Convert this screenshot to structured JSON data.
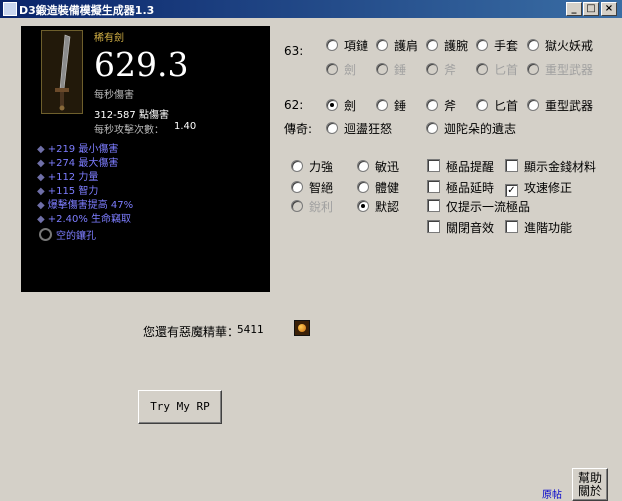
{
  "window": {
    "title": "D3鍛造裝備模擬生成器1.3",
    "minimize": "_",
    "maximize": "□",
    "close": "×"
  },
  "item": {
    "quality": "稀有劍",
    "dps": "629.3",
    "dps_label": "每秒傷害",
    "damage": "312-587 點傷害",
    "speed_label": "每秒攻擊次數：",
    "speed_value": "1.40",
    "stats": [
      "+219 最小傷害",
      "+274 最大傷害",
      "+112 力量",
      "+115 智力",
      "爆擊傷害提高 47%",
      "+2.40% 生命竊取"
    ],
    "socket": "空的鑲孔"
  },
  "row63": {
    "label": "63:",
    "options": [
      "項鏈",
      "護肩",
      "護腕",
      "手套",
      "獄火妖戒"
    ],
    "options_disabled": [
      "劍",
      "錘",
      "斧",
      "匕首",
      "重型武器"
    ]
  },
  "row62": {
    "label": "62:",
    "options": [
      "劍",
      "錘",
      "斧",
      "匕首",
      "重型武器"
    ],
    "selected": "劍"
  },
  "legend": {
    "label": "傳奇:",
    "options": [
      "迴盪狂怒",
      "迦陀朵的遺志"
    ]
  },
  "attributes": [
    "力強",
    "敏迅",
    "智絕",
    "體健",
    "銳利",
    "默認"
  ],
  "checkboxes": [
    {
      "label": "極品提醒",
      "checked": false
    },
    {
      "label": "顯示金錢材料",
      "checked": false
    },
    {
      "label": "極品延時",
      "checked": false
    },
    {
      "label": "攻速修正",
      "checked": true
    },
    {
      "label": "仅提示一流極品",
      "checked": false
    },
    {
      "label": "關閉音效",
      "checked": false
    },
    {
      "label": "進階功能",
      "checked": false
    }
  ],
  "essence": {
    "label": "您還有惡魔精華：",
    "value": "5411"
  },
  "try_button": "Try My RP",
  "help_button": "幫助關於",
  "bottom_link": "原帖"
}
